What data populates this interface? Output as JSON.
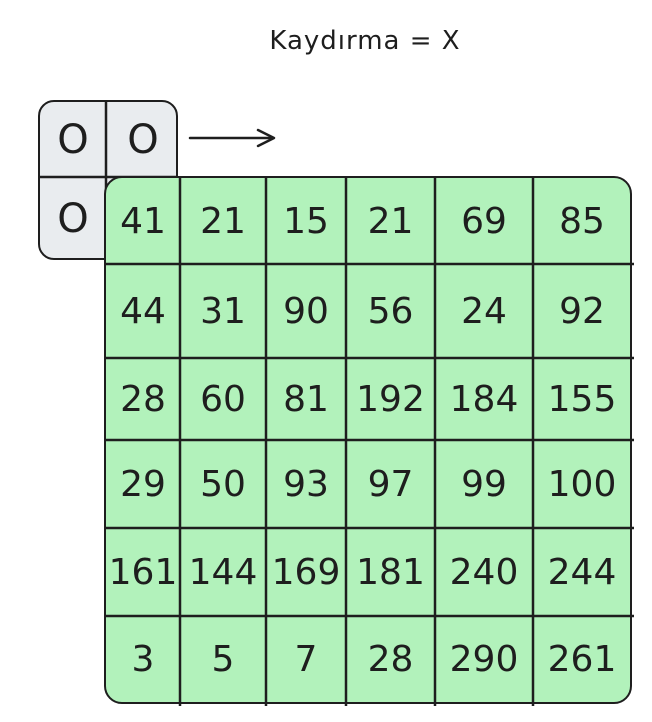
{
  "title": "Kaydırma = X",
  "kernel": {
    "cells": [
      "O",
      "O",
      "O",
      ""
    ]
  },
  "arrow_icon": "right-arrow-icon",
  "grid": {
    "rows": [
      [
        "41",
        "21",
        "15",
        "21",
        "69",
        "85"
      ],
      [
        "44",
        "31",
        "90",
        "56",
        "24",
        "92"
      ],
      [
        "28",
        "60",
        "81",
        "192",
        "184",
        "155"
      ],
      [
        "29",
        "50",
        "93",
        "97",
        "99",
        "100"
      ],
      [
        "161",
        "144",
        "169",
        "181",
        "240",
        "244"
      ],
      [
        "3",
        "5",
        "7",
        "28",
        "290",
        "261"
      ]
    ]
  },
  "colors": {
    "grid_fill": "#b2f2bb",
    "kernel_fill": "#e9ecef",
    "stroke": "#1e1e1e"
  }
}
